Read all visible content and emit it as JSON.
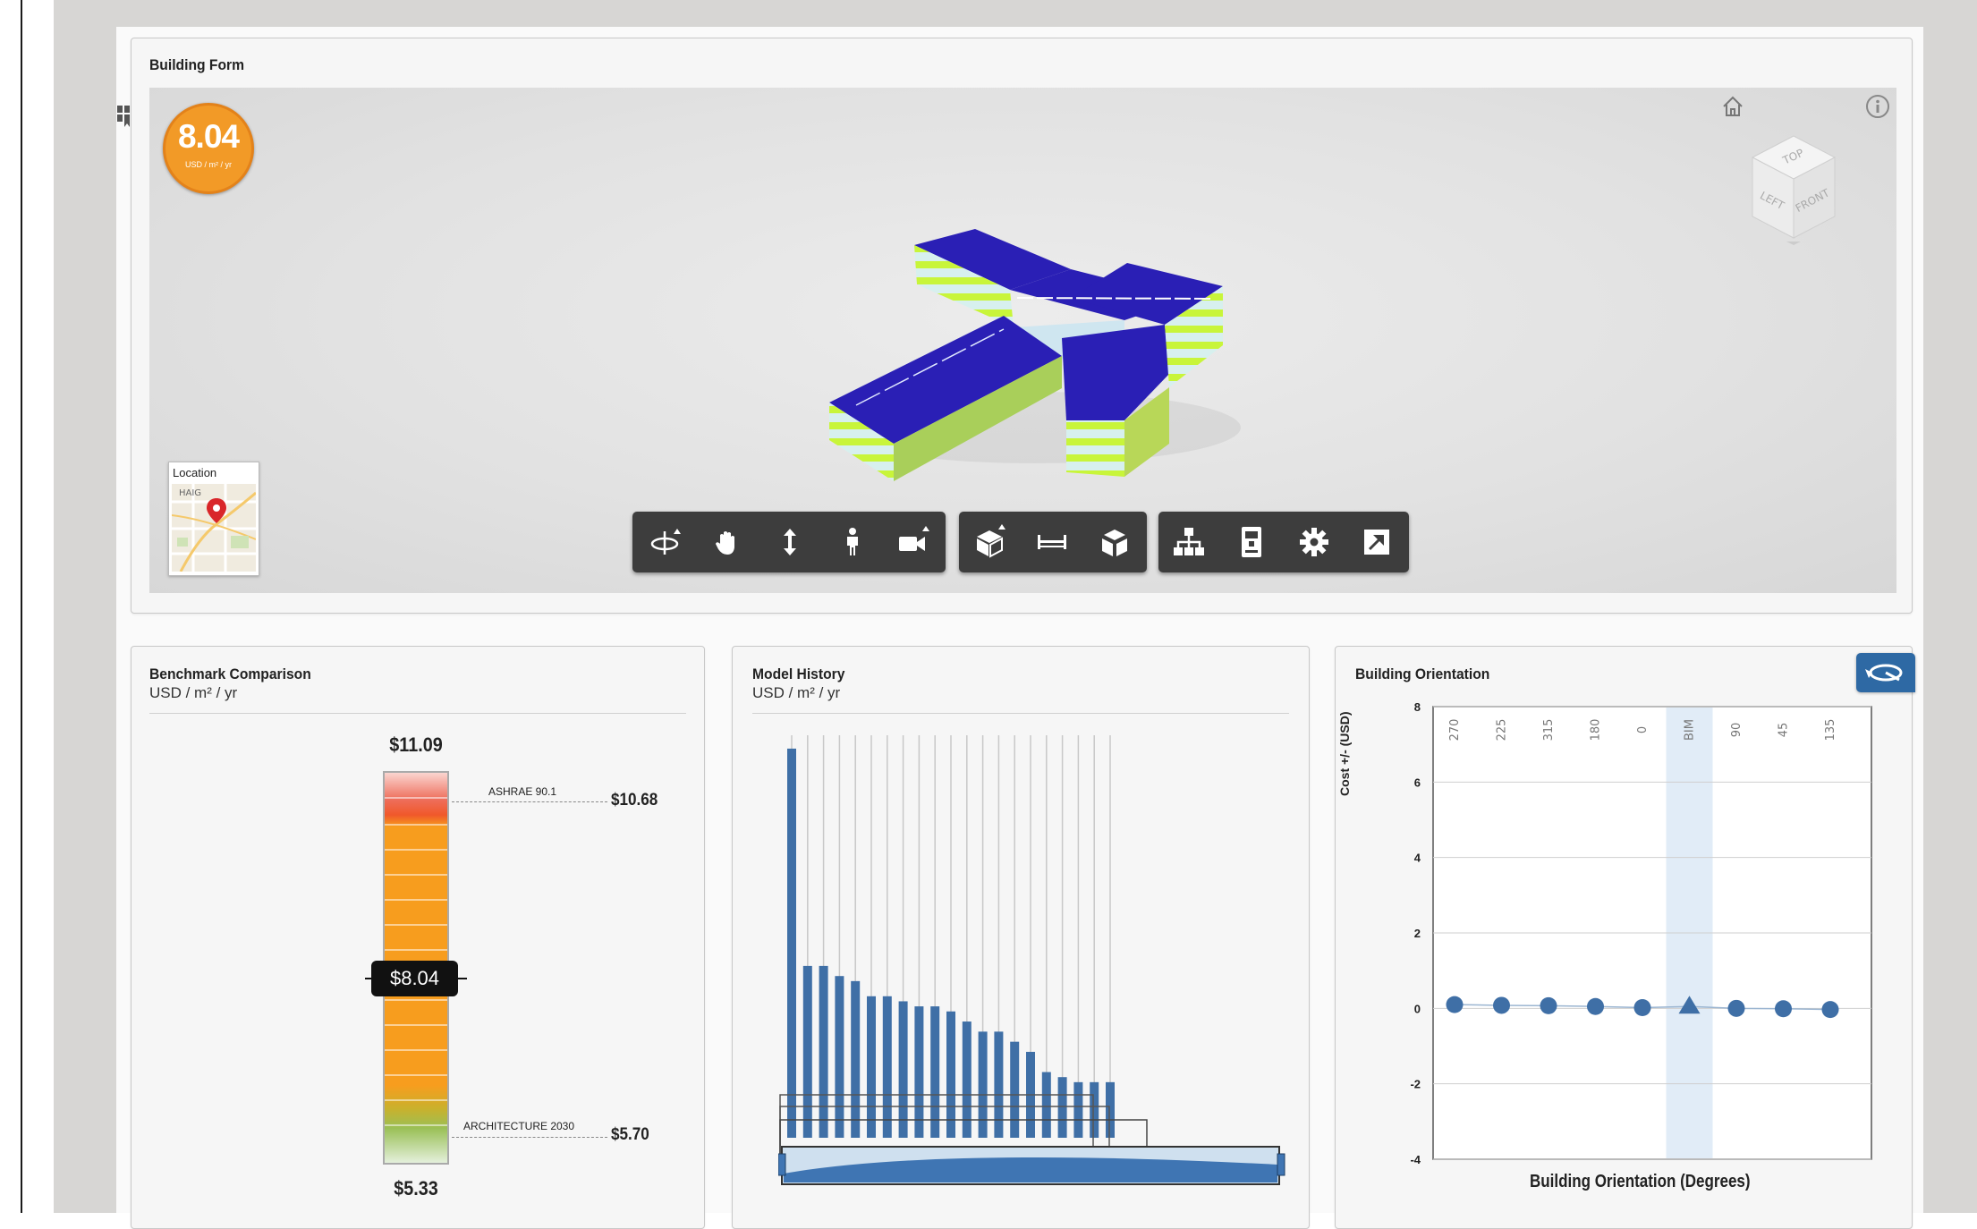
{
  "building_form": {
    "title": "Building Form",
    "score_value": "8.04",
    "score_unit": "USD / m² / yr",
    "location_label": "Location",
    "map_street": "HAIG",
    "viewcube": {
      "top": "TOP",
      "left": "LEFT",
      "front": "FRONT"
    },
    "toolbar_groups": [
      [
        "orbit-icon",
        "pan-icon",
        "zoom-icon",
        "walk-icon",
        "camera-icon"
      ],
      [
        "section-box-icon",
        "measure-icon",
        "explode-icon"
      ],
      [
        "model-browser-icon",
        "properties-icon",
        "settings-icon",
        "fullscreen-icon"
      ]
    ],
    "colors": {
      "roof": "#2a1fb5",
      "facade_band": "#c8f53a",
      "badge": "#f29a27"
    }
  },
  "benchmark": {
    "title": "Benchmark Comparison",
    "unit": "USD / m² / yr",
    "max_label": "$11.09",
    "min_label": "$5.33",
    "current_label": "$8.04",
    "markers": [
      {
        "name": "ASHRAE 90.1",
        "value_label": "$10.68"
      },
      {
        "name": "ARCHITECTURE 2030",
        "value_label": "$5.70"
      }
    ]
  },
  "model_history": {
    "title": "Model History",
    "unit": "USD / m² / yr"
  },
  "orientation": {
    "title": "Building Orientation",
    "xlabel": "Building Orientation (Degrees)",
    "ylabel": "Cost +/- (USD)"
  },
  "chart_data": [
    {
      "type": "bar",
      "title": "Model History",
      "subtitle": "USD / m² / yr",
      "values": [
        11.2,
        6.9,
        6.9,
        6.7,
        6.6,
        6.3,
        6.3,
        6.2,
        6.1,
        6.1,
        6.0,
        5.8,
        5.6,
        5.6,
        5.4,
        5.2,
        4.8,
        4.7,
        4.6,
        4.6,
        4.6
      ],
      "ylim": [
        3.5,
        11.5
      ]
    },
    {
      "type": "scatter",
      "title": "Building Orientation",
      "categories": [
        "270",
        "225",
        "315",
        "180",
        "0",
        "BIM",
        "90",
        "45",
        "135"
      ],
      "values": [
        0.1,
        0.08,
        0.07,
        0.05,
        0.02,
        0.05,
        0.0,
        -0.01,
        -0.03
      ],
      "highlight": "BIM",
      "ylim": [
        -4,
        8
      ],
      "yticks": [
        -4,
        -2,
        0,
        2,
        4,
        6,
        8
      ],
      "xlabel": "Building Orientation (Degrees)",
      "ylabel": "Cost +/- (USD)"
    }
  ]
}
